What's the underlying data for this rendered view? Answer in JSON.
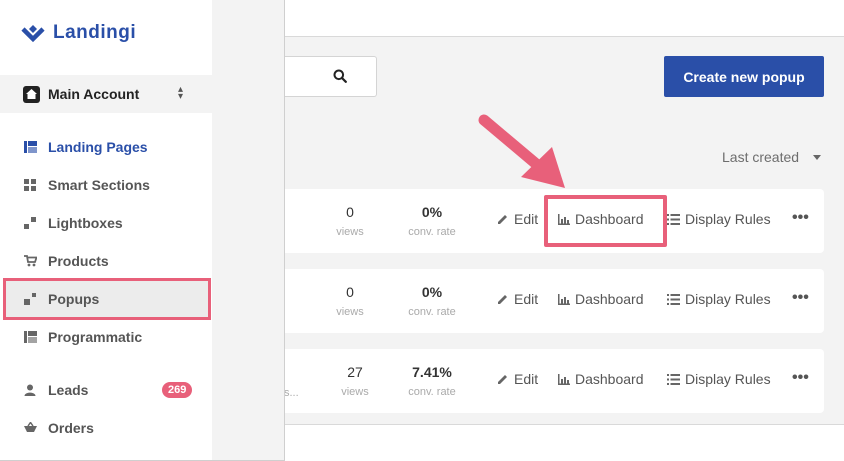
{
  "brand": {
    "name": "Landingi",
    "color": "#2a4fa8"
  },
  "account": {
    "name": "Main Account",
    "icon": "home-icon",
    "switch_icon": "chevron-updown-icon"
  },
  "sidebar": {
    "items": [
      {
        "label": "Landing Pages",
        "icon": "landing-pages-icon",
        "active": true
      },
      {
        "label": "Smart Sections",
        "icon": "smart-sections-icon"
      },
      {
        "label": "Lightboxes",
        "icon": "lightboxes-icon"
      },
      {
        "label": "Products",
        "icon": "cart-icon"
      },
      {
        "label": "Popups",
        "icon": "popups-icon",
        "highlighted": true
      },
      {
        "label": "Programmatic",
        "icon": "programmatic-icon"
      },
      {
        "label": "Leads",
        "icon": "person-icon",
        "badge": "269"
      },
      {
        "label": "Orders",
        "icon": "orders-icon"
      }
    ]
  },
  "toolbar": {
    "search_icon": "search-icon",
    "create_label": "Create new popup",
    "sort_label": "Last created"
  },
  "rows": [
    {
      "views": "0",
      "views_label": "views",
      "rate": "0%",
      "rate_label": "conv. rate",
      "truncated": ""
    },
    {
      "views": "0",
      "views_label": "views",
      "rate": "0%",
      "rate_label": "conv. rate",
      "truncated": ""
    },
    {
      "views": "27",
      "views_label": "views",
      "rate": "7.41%",
      "rate_label": "conv. rate",
      "truncated": "s..."
    }
  ],
  "actions": {
    "edit": "Edit",
    "dashboard": "Dashboard",
    "rules": "Display Rules",
    "more": "•••"
  },
  "colors": {
    "accent": "#2a4fa8",
    "highlight": "#e8607a",
    "badge": "#e8607a"
  }
}
